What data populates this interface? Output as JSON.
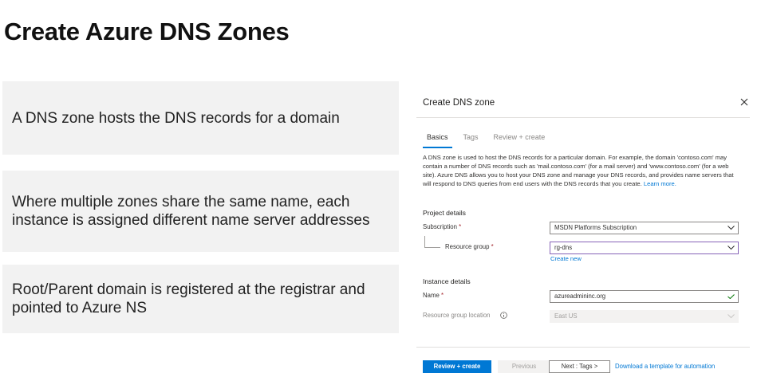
{
  "slide": {
    "title": "Create Azure DNS Zones",
    "points": [
      "A DNS zone hosts the DNS records for a domain",
      "Where multiple zones share the same name, each instance is assigned different name server addresses",
      "Root/Parent domain is registered at the registrar and pointed to Azure NS"
    ]
  },
  "panel": {
    "title": "Create DNS zone",
    "tabs": [
      "Basics",
      "Tags",
      "Review + create"
    ],
    "active_tab": "Basics",
    "description": "A DNS zone is used to host the DNS records for a particular domain. For example, the domain 'contoso.com' may contain a number of DNS records such as 'mail.contoso.com' (for a mail server) and 'www.contoso.com' (for a web site). Azure DNS allows you to host your DNS zone and manage your DNS records, and provides name servers that will respond to DNS queries from end users with the DNS records that you create.",
    "learn_more": "Learn more.",
    "project_details": {
      "heading": "Project details",
      "subscription_label": "Subscription",
      "subscription_value": "MSDN Platforms Subscription",
      "resource_group_label": "Resource group",
      "resource_group_value": "rg-dns",
      "create_new": "Create new"
    },
    "instance_details": {
      "heading": "Instance details",
      "name_label": "Name",
      "name_value": "azureadmininc.org",
      "location_label": "Resource group location",
      "location_value": "East US"
    },
    "required_mark": "*",
    "footer": {
      "review_create": "Review + create",
      "previous": "Previous",
      "next": "Next : Tags >",
      "download_template": "Download a template for automation"
    },
    "colors": {
      "accent": "#0078d4",
      "focus_border": "#8764b8",
      "valid_check": "#107c10",
      "required": "#a4262c"
    }
  }
}
